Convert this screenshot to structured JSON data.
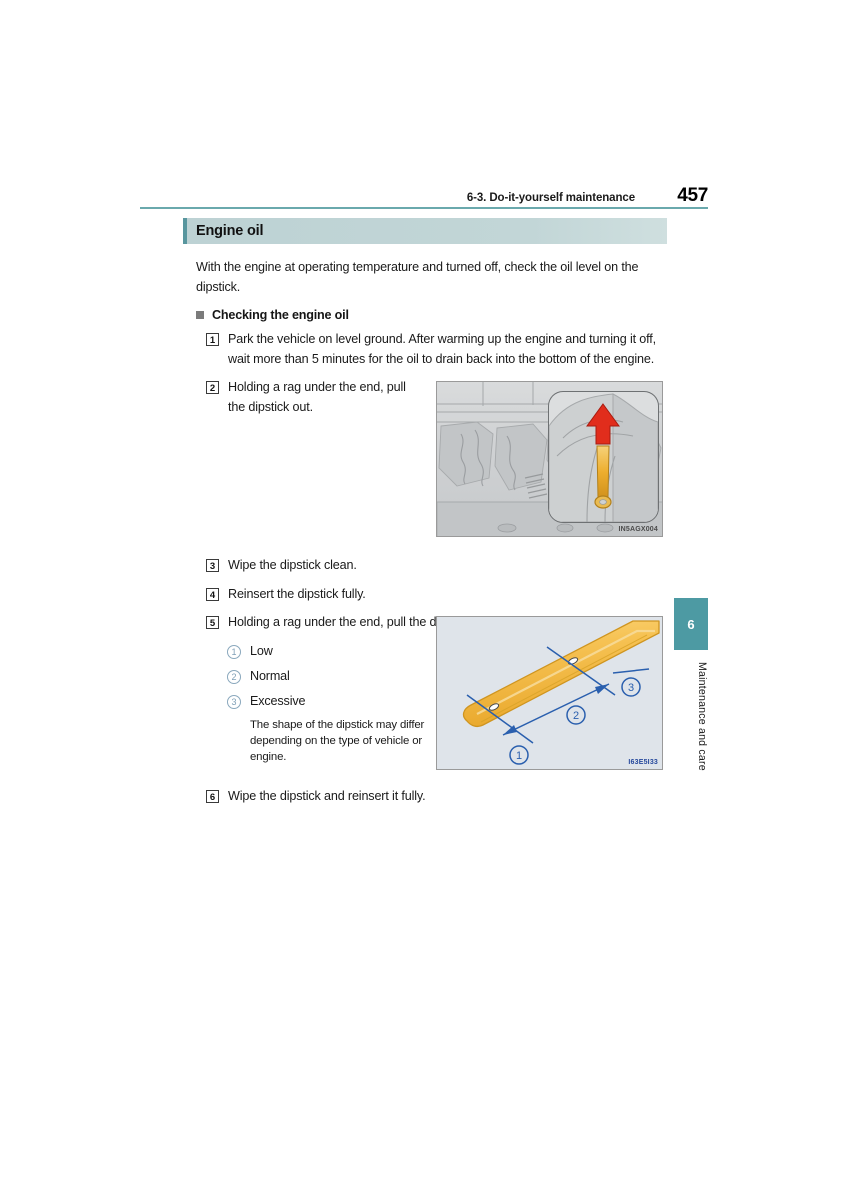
{
  "header": {
    "section_title": "6-3. Do-it-yourself maintenance",
    "page_number": "457"
  },
  "section": {
    "heading": "Engine oil",
    "lead": "With the engine at operating temperature and turned off, check the oil level on the dipstick.",
    "subheading": "Checking the engine oil"
  },
  "steps": [
    {
      "num": "1",
      "text": "Park the vehicle on level ground. After warming up the engine and turning it off, wait more than 5 minutes for the oil to drain back into the bottom of the engine."
    },
    {
      "num": "2",
      "text": "Holding a rag under the end, pull the dipstick out."
    },
    {
      "num": "3",
      "text": "Wipe the dipstick clean."
    },
    {
      "num": "4",
      "text": "Reinsert the dipstick fully."
    },
    {
      "num": "5",
      "text": "Holding a rag under the end, pull the dipstick out and check the oil level."
    },
    {
      "num": "6",
      "text": "Wipe the dipstick and reinsert it fully."
    }
  ],
  "oil_levels": [
    {
      "num": "1",
      "label": "Low"
    },
    {
      "num": "2",
      "label": "Normal"
    },
    {
      "num": "3",
      "label": "Excessive"
    }
  ],
  "oil_levels_note": "The shape of the dipstick may differ depending on the type of vehicle or engine.",
  "figures": {
    "engine_bay": {
      "code": "IN5AGX004",
      "description": "Engine compartment with magnified callout of the oil dipstick handle and a red upward arrow indicating pulling the dipstick out."
    },
    "dipstick": {
      "code": "I63E5I33",
      "description": "Close-up of the dipstick tip with blue dimension callouts marking the low, normal and excessive oil level ranges.",
      "callouts": [
        "1",
        "2",
        "3"
      ]
    }
  },
  "side_tab": {
    "chapter_number": "6",
    "chapter_name": "Maintenance and care"
  },
  "colors": {
    "accent_teal": "#4d9aa3",
    "heading_bar": "#bdd2d4",
    "rule_teal": "#6aa9ad",
    "callout_blue": "#2a5fae",
    "dipstick_orange": "#f3b93f",
    "arrow_red": "#e03020"
  }
}
